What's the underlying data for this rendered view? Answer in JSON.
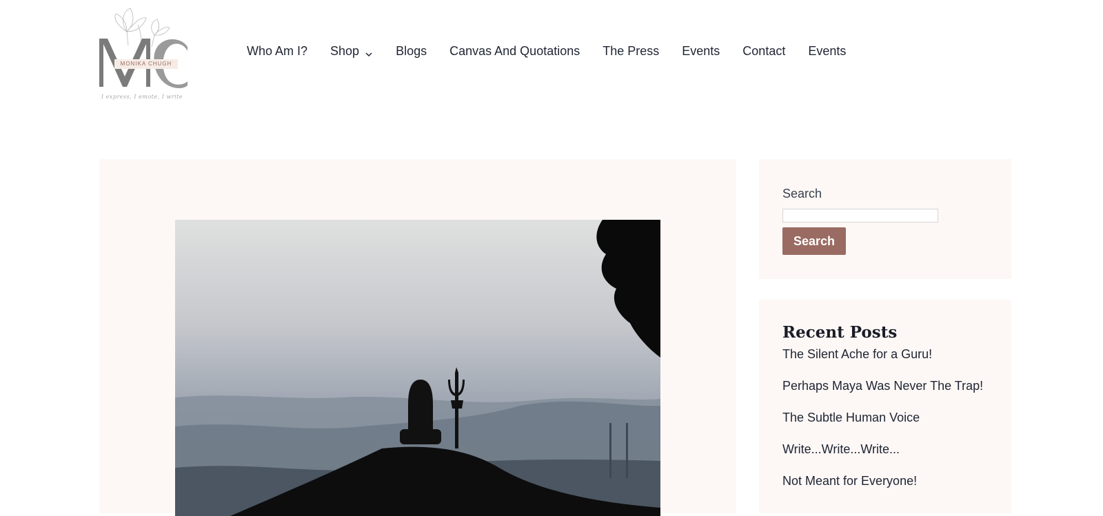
{
  "logo": {
    "monogram": "MC",
    "name": "MONIKA CHUGH",
    "tagline": "I express, I emote, I write",
    "icon": "lotus-monogram-icon"
  },
  "nav": {
    "items": [
      {
        "label": "Who Am I?"
      },
      {
        "label": "Shop",
        "icon": "chevron-down-icon"
      },
      {
        "label": "Blogs"
      },
      {
        "label": "Canvas And Quotations"
      },
      {
        "label": "The Press"
      },
      {
        "label": "Events"
      },
      {
        "label": "Contact"
      },
      {
        "label": "Events"
      }
    ]
  },
  "featured_image": {
    "subject": "shiva-lingam-trident-silhouette-image"
  },
  "sidebar": {
    "search": {
      "label": "Search",
      "placeholder": "",
      "button_label": "Search"
    },
    "recent_posts": {
      "title": "Recent Posts",
      "items": [
        "The Silent Ache for a Guru!",
        "Perhaps Maya Was Never The Trap!",
        "The Subtle Human Voice",
        "Write...Write...Write...",
        "Not Meant for Everyone!"
      ]
    }
  },
  "colors": {
    "card_background": "#fdf8f6",
    "button": "#9a6b62",
    "text": "#1e2432"
  }
}
